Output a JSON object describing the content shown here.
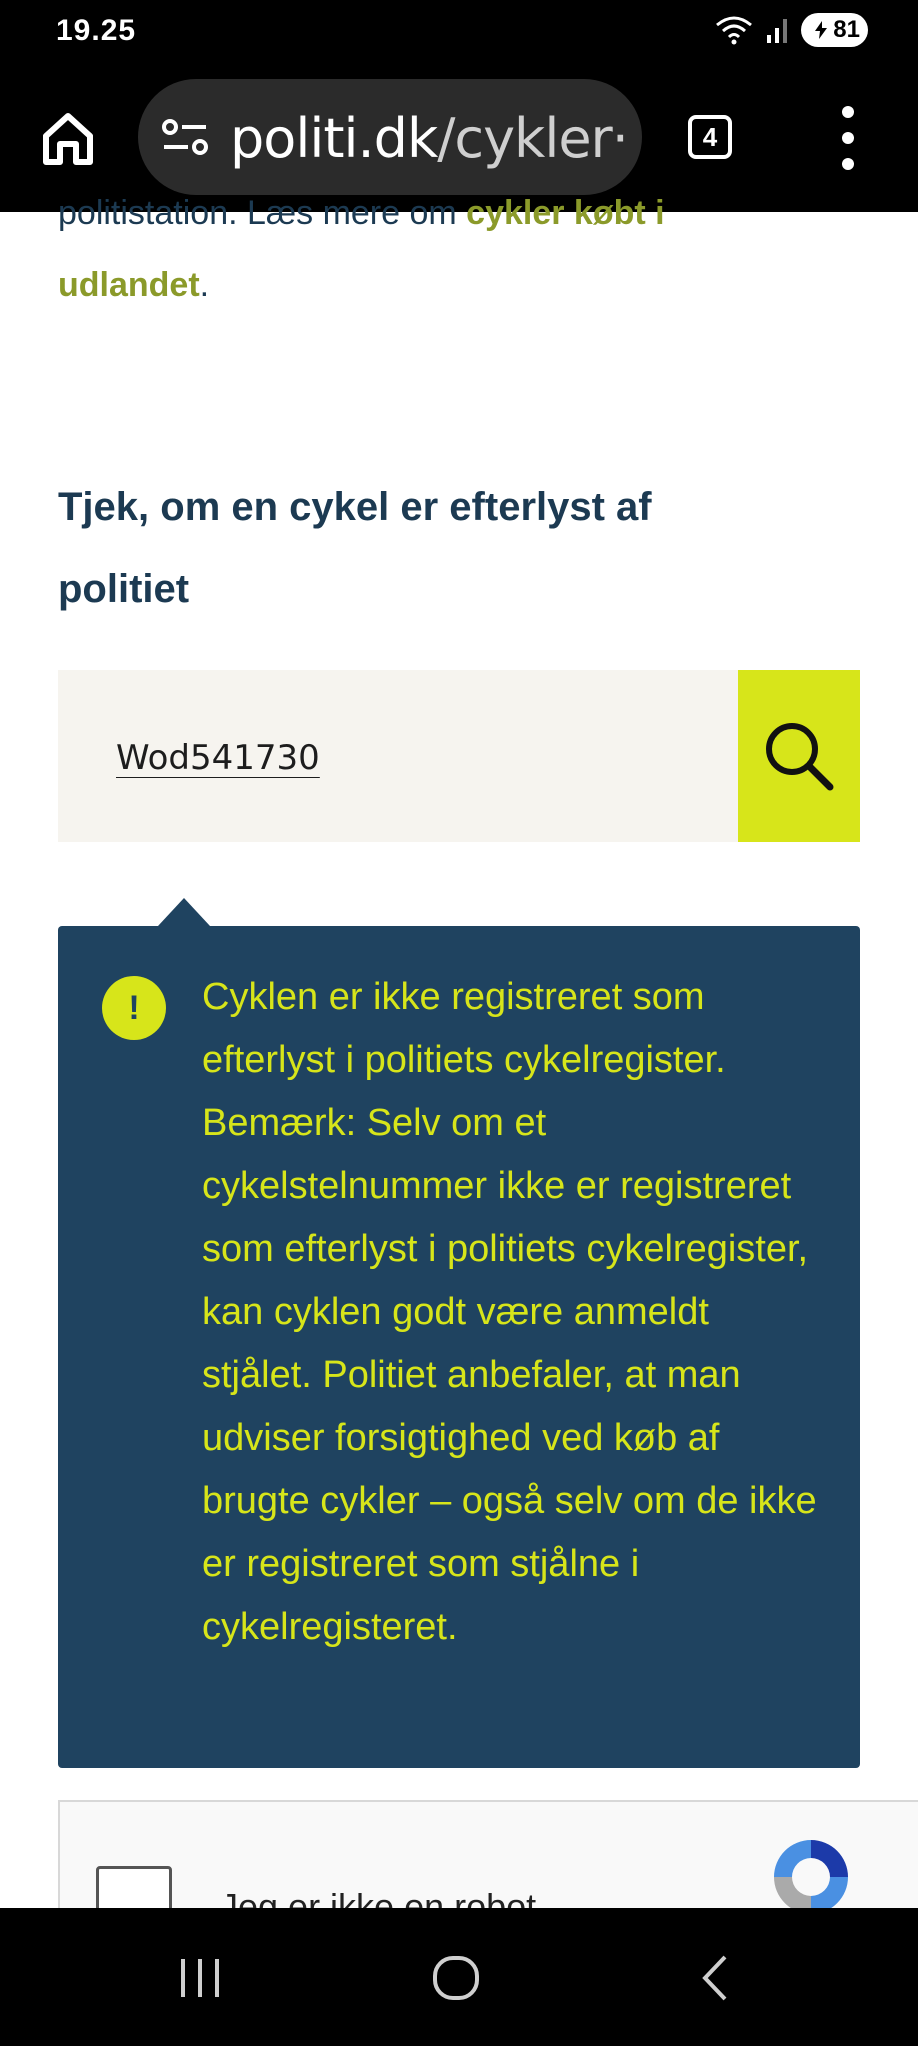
{
  "status_bar": {
    "time": "19.25",
    "battery": "81",
    "icons": [
      "wifi-icon",
      "signal-icon",
      "battery-icon"
    ]
  },
  "browser": {
    "url_domain": "politi.dk",
    "url_path": "/cykler·",
    "tab_count": "4",
    "icons": [
      "home-icon",
      "site-settings-icon",
      "tabs-icon",
      "menu-icon"
    ]
  },
  "content": {
    "cut_text_prefix": "politistation. Læs mere om ",
    "cut_text_link": "cykler købt i",
    "link_line": "udlandet",
    "link_line_suffix": ".",
    "section_title": "Tjek, om en cykel er efterlyst af politiet",
    "search": {
      "value": "Wod541730",
      "button_icon": "search-icon"
    },
    "notice": {
      "icon_text": "!",
      "text": "Cyklen er ikke registreret som efterlyst i politiets cykelregister. Bemærk: Selv om et cykelstelnummer ikke er registreret som efterlyst i politiets cykelregister, kan cyklen godt være anmeldt stjålet. Politiet anbefaler, at man udviser forsigtighed ved køb af brugte cykler – også selv om de ikke er registreret som stjålne i cykelregisteret."
    },
    "captcha": {
      "label": "Jeg er ikke en robot"
    }
  },
  "colors": {
    "brand_dark": "#1f4360",
    "accent": "#d7e51a",
    "link": "#8b9a2a",
    "search_bg": "#f6f4ef"
  },
  "nav_bar": {
    "icons": [
      "recents-icon",
      "home-circle-icon",
      "back-icon"
    ]
  }
}
